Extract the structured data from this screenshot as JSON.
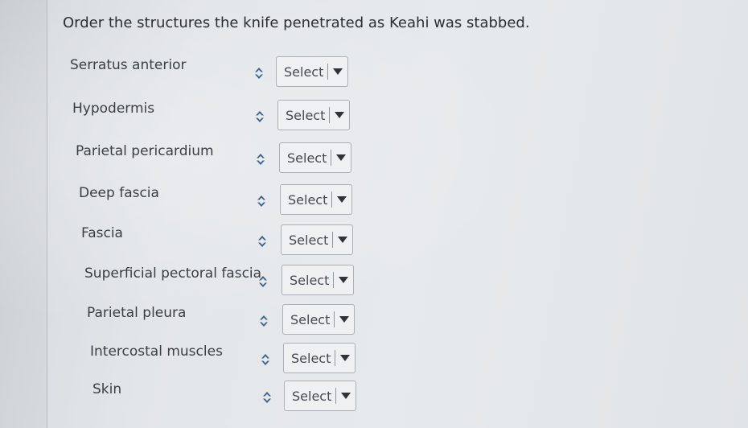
{
  "question": "Order the structures the knife penetrated as Keahi was stabbed.",
  "select_placeholder": "Select",
  "icons": {
    "sort": "sort-arrows-icon",
    "dropdown": "dropdown-caret-icon"
  },
  "colors": {
    "text": "#3a3f44",
    "background": "#e3e6e8",
    "border": "#aab0b5"
  },
  "items": [
    {
      "label": "Serratus anterior",
      "selected": "Select"
    },
    {
      "label": "Hypodermis",
      "selected": "Select"
    },
    {
      "label": "Parietal pericardium",
      "selected": "Select"
    },
    {
      "label": "Deep fascia",
      "selected": "Select"
    },
    {
      "label": "Fascia",
      "selected": "Select"
    },
    {
      "label": "Superficial pectoral fascia",
      "selected": "Select"
    },
    {
      "label": "Parietal pleura",
      "selected": "Select"
    },
    {
      "label": "Intercostal muscles",
      "selected": "Select"
    },
    {
      "label": "Skin",
      "selected": "Select"
    }
  ]
}
